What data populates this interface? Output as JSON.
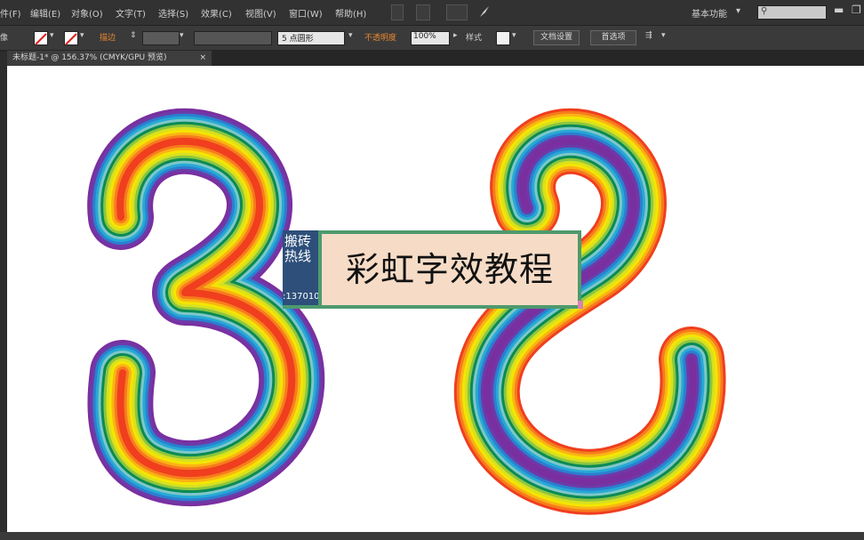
{
  "menubar": {
    "items": [
      "件(F)",
      "编辑(E)",
      "对象(O)",
      "文字(T)",
      "选择(S)",
      "效果(C)",
      "视图(V)",
      "窗口(W)",
      "帮助(H)"
    ],
    "workspace": "基本功能",
    "search_placeholder": ""
  },
  "controlbar": {
    "stroke_label": "描边",
    "brush_label": "5 点圆形",
    "opacity_label": "不透明度",
    "opacity_value": "100%",
    "style_label": "样式",
    "doc_setup_label": "文档设置",
    "prefs_label": "首选项",
    "left_label": "像"
  },
  "tab": {
    "title": "未标题-1* @ 156.37% (CMYK/GPU 预览)",
    "close": "×"
  },
  "canvas": {
    "digits": [
      "3",
      "2"
    ]
  },
  "overlay": {
    "title": "彩虹字效教程",
    "watermark_line1": "搬砖",
    "watermark_line2": "热线",
    "watermark_number": ":137010"
  },
  "colors": {
    "rainbow": [
      "#7a2fa0",
      "#6d3ba8",
      "#2b7fd0",
      "#26a9d6",
      "#7ec7c8",
      "#0b8a55",
      "#8cc63f",
      "#d8e021",
      "#f3e600",
      "#fbb315",
      "#f67c1c",
      "#f03e1f"
    ]
  }
}
